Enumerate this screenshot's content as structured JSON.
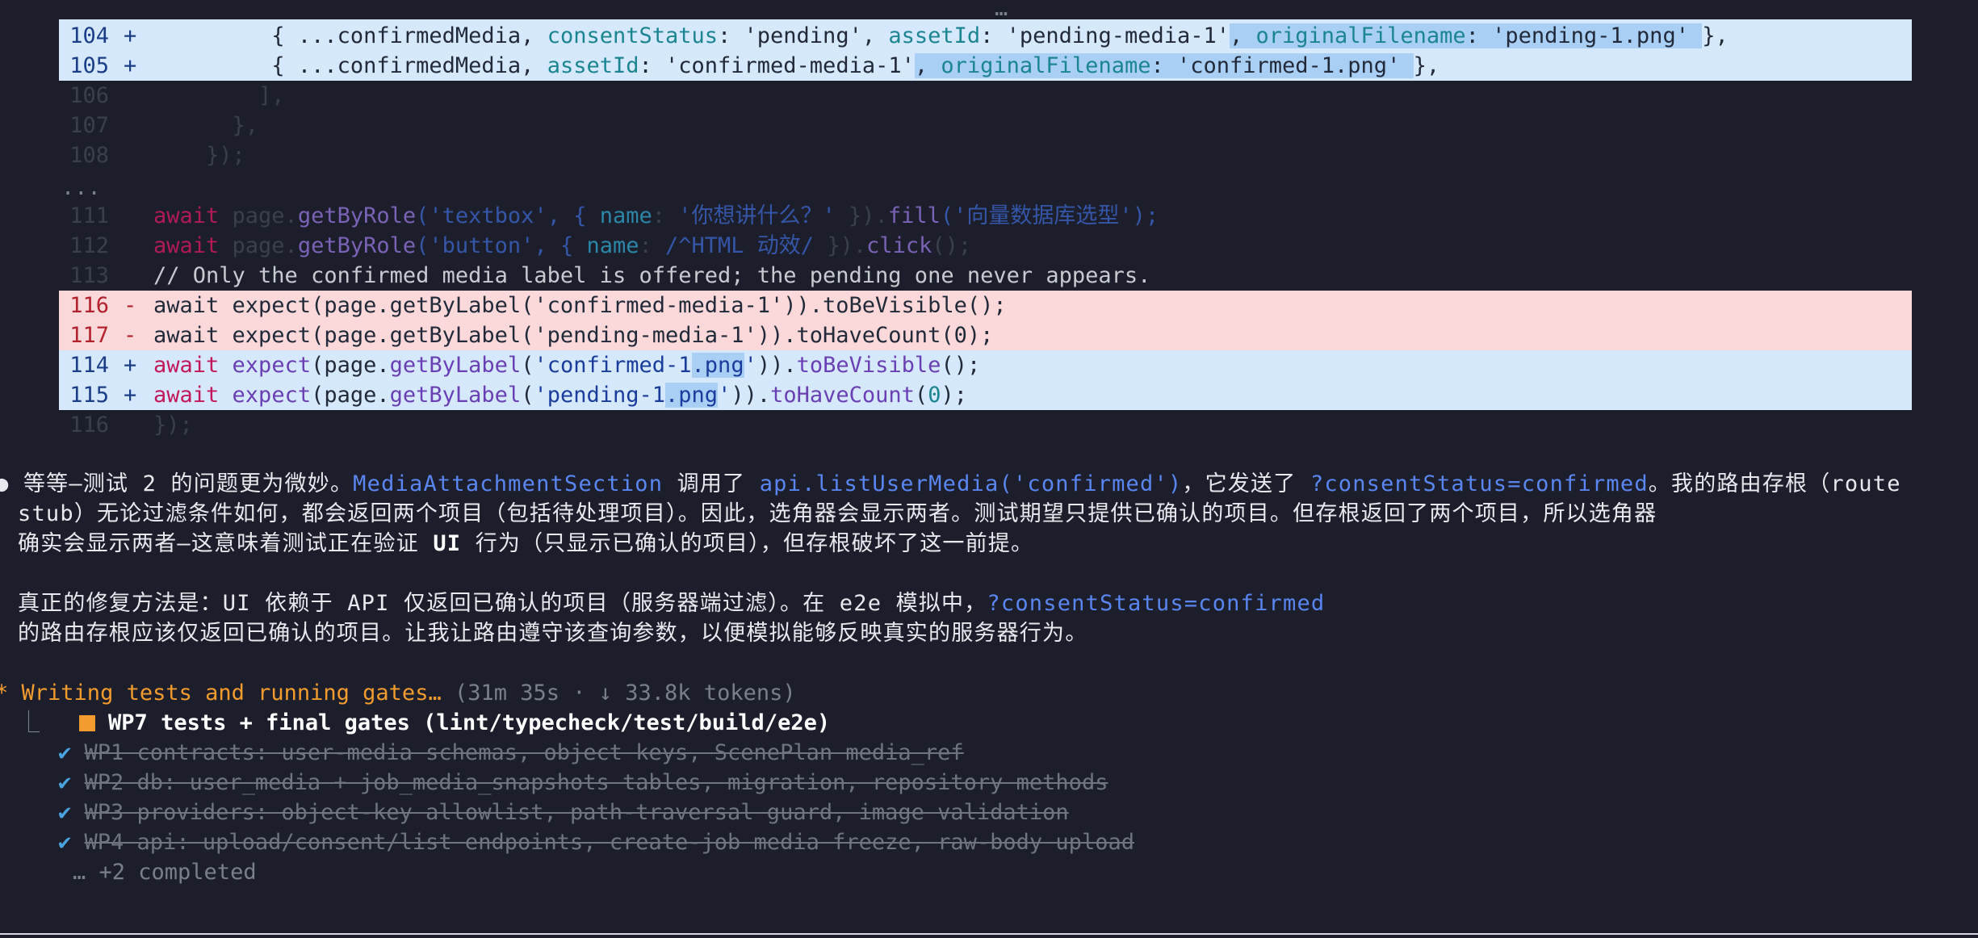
{
  "top_ellipsis": "…",
  "diff": {
    "added_top": [
      {
        "num": "104",
        "sign": "+",
        "indent": "         ",
        "p1": "{ ...confirmedMedia, ",
        "k1": "consentStatus",
        "v1": ": 'pending', ",
        "k2": "assetId",
        "v2": ": 'pending-media-1'",
        "sep": ", ",
        "k3": "originalFilename",
        "v3": ": 'pending-1.png' ",
        "end": "},"
      },
      {
        "num": "105",
        "sign": "+",
        "indent": "         ",
        "p1": "{ ...confirmedMedia, ",
        "k1": "assetId",
        "v1": ": 'confirmed-media-1'",
        "sep": ", ",
        "k2": "originalFilename",
        "v2": ": 'confirmed-1.png' ",
        "end": "},"
      }
    ],
    "context_top": [
      {
        "num": "106",
        "text": "        ],"
      },
      {
        "num": "107",
        "text": "      },"
      },
      {
        "num": "108",
        "text": "    });"
      }
    ],
    "skip": "...",
    "context_mid": {
      "l111": {
        "num": "111",
        "kw": "await",
        "a": " page.",
        "fn": "getByRole",
        "b": "('textbox', { ",
        "prop": "name",
        "c": ": ",
        "str": "'你想讲什么？'",
        "d": " }).",
        "fn2": "fill",
        "e": "('向量数据库选型');"
      },
      "l112": {
        "num": "112",
        "kw": "await",
        "a": " page.",
        "fn": "getByRole",
        "b": "('button', { ",
        "prop": "name",
        "c": ": ",
        "str": "/^HTML 动效/",
        "d": " }).",
        "fn2": "click",
        "e": "();"
      },
      "l113": {
        "num": "113",
        "text": "// Only the confirmed media label is offered; the pending one never appears."
      }
    },
    "removed": [
      {
        "num": "116",
        "sign": "-",
        "text": "await expect(page.getByLabel('confirmed-media-1')).toBeVisible();"
      },
      {
        "num": "117",
        "sign": "-",
        "text": "await expect(page.getByLabel('pending-media-1')).toHaveCount(0);"
      }
    ],
    "added_bottom": [
      {
        "num": "114",
        "sign": "+",
        "kw": "await",
        "a": " ",
        "fn1": "expect",
        "b": "(page.",
        "fn2": "getByLabel",
        "c": "(",
        "s1": "'confirmed-1",
        "s2": ".png",
        "s3": "'",
        "d": ")).",
        "fn3": "toBeVisible",
        "e": "();"
      },
      {
        "num": "115",
        "sign": "+",
        "kw": "await",
        "a": " ",
        "fn1": "expect",
        "b": "(page.",
        "fn2": "getByLabel",
        "c": "(",
        "s1": "'pending-1",
        "s2": ".png",
        "s3": "'",
        "d": ")).",
        "fn3": "toHaveCount",
        "e": "(",
        "n": "0",
        "f": ");"
      }
    ],
    "context_bottom": {
      "num": "116",
      "text": "});"
    }
  },
  "message": {
    "bullet": "●",
    "p1_line1_a": "等等—测试 2 的问题更为微妙。",
    "p1_code1": "MediaAttachmentSection",
    "p1_line1_b": " 调用了 ",
    "p1_code2": "api.listUserMedia('confirmed')",
    "p1_line1_c": "，它发送了 ",
    "p1_code3": "?consentStatus=confirmed",
    "p1_line1_d": "。我的路由存根（route",
    "p1_line2": "stub）无论过滤条件如何，都会返回两个项目（包括待处理项目）。因此，选角器会显示两者。测试期望只提供已确认的项目。但存根返回了两个项目，所以选角器",
    "p1_line3_a": "确实会显示两者—这意味着测试正在验证 ",
    "p1_line3_ui": "UI",
    "p1_line3_b": " 行为（只显示已确认的项目），但存根破坏了这一前提。",
    "p2_line1_a": "真正的修复方法是：UI 依赖于 API 仅返回已确认的项目（服务器端过滤）。在 e2e 模拟中，",
    "p2_code": "?consentStatus=confirmed",
    "p2_line2": "的路由存根应该仅返回已确认的项目。让我让路由遵守该查询参数，以便模拟能够反映真实的服务器行为。"
  },
  "status": {
    "spinner": "*",
    "label": "Writing tests and running gates…",
    "meta": " (31m 35s · ↓ 33.8k tokens)"
  },
  "tasks": {
    "tree_glyph": "⎿",
    "current": "WP7 tests + final gates (lint/typecheck/test/build/e2e)",
    "completed": [
      {
        "check": "✔",
        "text": "WP1 contracts: user-media schemas, object keys, ScenePlan media_ref"
      },
      {
        "check": "✔",
        "text": "WP2 db: user_media + job_media_snapshots tables, migration, repository methods"
      },
      {
        "check": "✔",
        "text": "WP3 providers: object-key allowlist, path-traversal guard, image validation"
      },
      {
        "check": "✔",
        "text": "WP4 api: upload/consent/list endpoints, create-job media freeze, raw-body upload"
      }
    ],
    "more": "… +2 completed"
  },
  "colors": {
    "background": "#1c1f2b",
    "added_bg": "#d6e8fb",
    "removed_bg": "#fbd9da",
    "accent_orange": "#f29b2e",
    "link_blue": "#5a86f2"
  }
}
